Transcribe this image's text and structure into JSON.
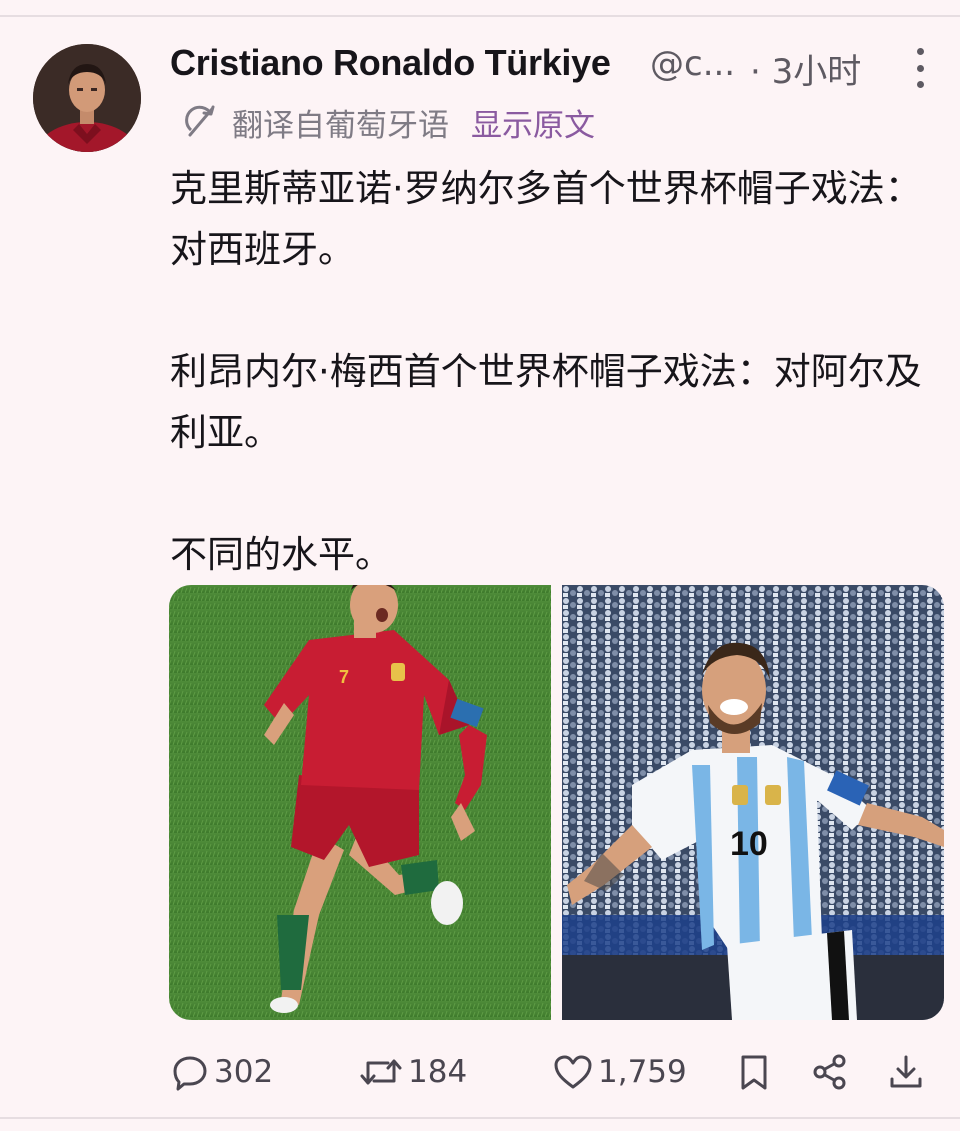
{
  "post": {
    "display_name": "Cristiano Ronaldo Türkiye",
    "handle": "@c...",
    "timestamp": "· 3小时",
    "translation": {
      "label": "翻译自葡萄牙语",
      "show_original": "显示原文"
    },
    "text": {
      "line1": "克里斯蒂亚诺·罗纳尔多首个世界杯帽子戏法：对西班牙。",
      "line2": "利昂内尔·梅西首个世界杯帽子戏法：对阿尔及利亚。",
      "line3": "不同的水平。"
    },
    "media": [
      {
        "subject": "ronaldo-photo"
      },
      {
        "subject": "messi-photo"
      }
    ]
  },
  "actions": {
    "replies": "302",
    "reposts": "184",
    "likes": "1,759"
  },
  "icons": {
    "more": "more-vertical-icon",
    "translate": "translate-icon",
    "reply": "reply-icon",
    "repost": "repost-icon",
    "like": "heart-icon",
    "bookmark": "bookmark-icon",
    "share": "share-icon",
    "download": "download-icon"
  },
  "colors": {
    "background": "#fdf4f6",
    "link": "#8a5aa0",
    "muted": "#5e5a62"
  }
}
